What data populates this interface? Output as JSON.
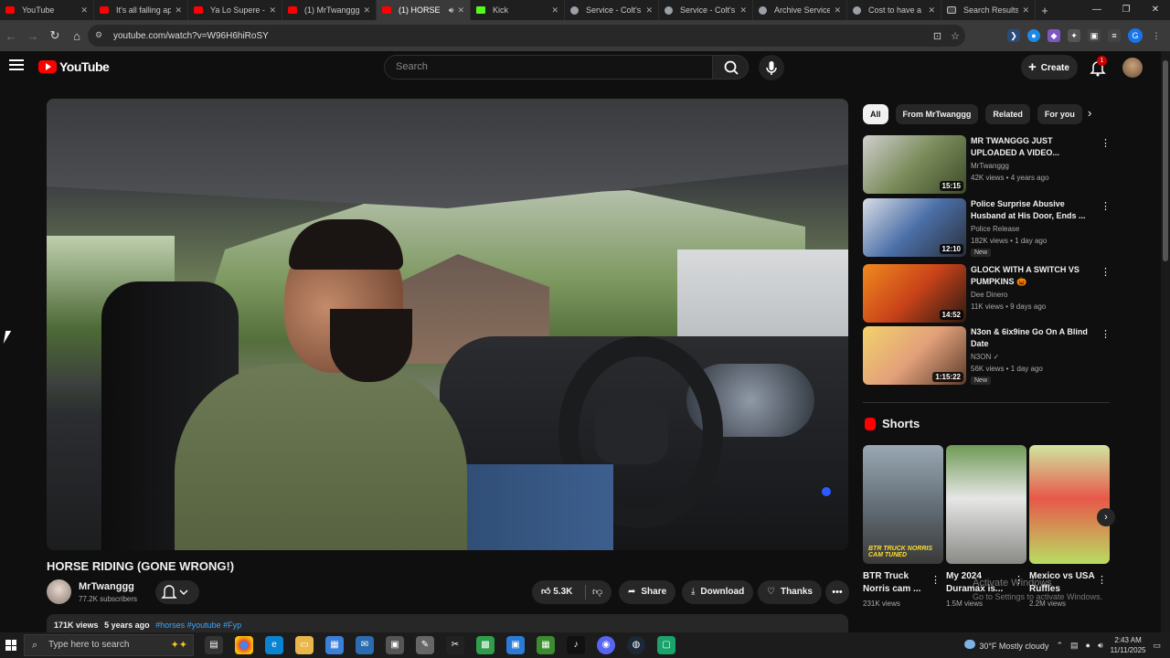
{
  "browser": {
    "tabs": [
      {
        "label": "YouTube",
        "favicon": "youtube",
        "active": false
      },
      {
        "label": "It's all falling ap",
        "favicon": "youtube",
        "active": false
      },
      {
        "label": "Ya Lo Supere -",
        "favicon": "youtube",
        "active": false
      },
      {
        "label": "(1) MrTwanggg",
        "favicon": "youtube",
        "active": false
      },
      {
        "label": "(1) HORSE",
        "favicon": "youtube",
        "active": true
      },
      {
        "label": "Kick",
        "favicon": "kick",
        "active": false
      },
      {
        "label": "Service - Colt's",
        "favicon": "generic",
        "active": false
      },
      {
        "label": "Service - Colt's",
        "favicon": "generic",
        "active": false
      },
      {
        "label": "Archive Service",
        "favicon": "generic",
        "active": false
      },
      {
        "label": "Cost to have a",
        "favicon": "generic",
        "active": false
      },
      {
        "label": "Search Results",
        "favicon": "ugg",
        "active": false
      }
    ],
    "url": "youtube.com/watch?v=W96H6hiRoSY",
    "profile_initial": "G"
  },
  "youtube": {
    "logo_text": "YouTube",
    "search_placeholder": "Search",
    "create_label": "Create",
    "notification_count": "1"
  },
  "video": {
    "title": "HORSE RIDING (GONE WRONG!)",
    "channel": "MrTwanggg",
    "subscribers": "77.2K subscribers",
    "likes": "5.3K",
    "share_label": "Share",
    "download_label": "Download",
    "thanks_label": "Thanks",
    "views": "171K views",
    "age": "5 years ago",
    "tags": "#horses #youtube #Fyp"
  },
  "sidebar": {
    "chips": [
      "All",
      "From MrTwanggg",
      "Related",
      "For you"
    ],
    "recommendations": [
      {
        "title": "MR TWANGGG JUST UPLOADED A VIDEO...",
        "channel": "MrTwanggg",
        "meta": "42K views • 4 years ago",
        "duration": "15:15",
        "badge": ""
      },
      {
        "title": "Police Surprise Abusive Husband at His Door, Ends ...",
        "channel": "Police Release",
        "meta": "182K views • 1 day ago",
        "duration": "12:10",
        "badge": "New"
      },
      {
        "title": "GLOCK WITH A SWITCH VS PUMPKINS 🎃",
        "channel": "Dee Dinero",
        "meta": "11K views • 9 days ago",
        "duration": "14:52",
        "badge": ""
      },
      {
        "title": "N3on & 6ix9ine Go On A Blind Date",
        "channel": "N3ON ✓",
        "meta": "56K views • 1 day ago",
        "duration": "1:15:22",
        "badge": "New"
      }
    ],
    "shorts_title": "Shorts",
    "shorts": [
      {
        "title": "BTR Truck Norris cam ...",
        "views": "231K views",
        "caption": "BTR TRUCK NORRIS CAM TUNED"
      },
      {
        "title": "My 2024 Duramax is...",
        "views": "1.5M views",
        "caption": ""
      },
      {
        "title": "Mexico vs USA Ruffles",
        "views": "2.2M views",
        "caption": ""
      }
    ]
  },
  "watermark": {
    "line1": "Activate Windows",
    "line2": "Go to Settings to activate Windows."
  },
  "taskbar": {
    "search_placeholder": "Type here to search",
    "weather": "30°F  Mostly cloudy",
    "time": "2:43 AM",
    "date": "11/11/2025"
  }
}
